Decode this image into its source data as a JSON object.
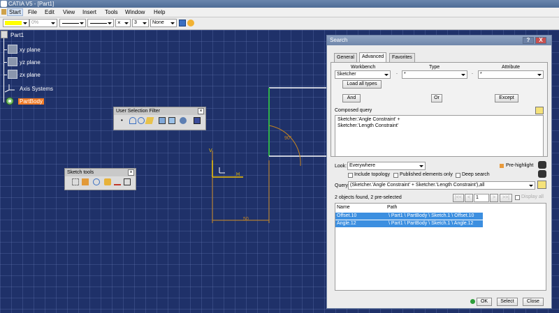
{
  "window": {
    "title": "CATIA V5 - [Part1]"
  },
  "menu": [
    "Start",
    "File",
    "Edit",
    "View",
    "Insert",
    "Tools",
    "Window",
    "Help"
  ],
  "style_toolbar": {
    "opacity": "0%",
    "thickness": "3",
    "layer": "None"
  },
  "tree": {
    "root": "Part1",
    "items": [
      "xy plane",
      "yz plane",
      "zx plane",
      "Axis Systems",
      "PartBody"
    ]
  },
  "sketch": {
    "angle_label": "90°",
    "length_label": "50",
    "axis_h": "H",
    "axis_v": "V"
  },
  "user_selection_filter": {
    "title": "User Selection Filter"
  },
  "sketch_tools": {
    "title": "Sketch tools"
  },
  "search": {
    "title": "Search",
    "help": "?",
    "close": "X",
    "tabs": [
      "General",
      "Advanced",
      "Favorites"
    ],
    "columns": {
      "workbench": "Workbench",
      "type": "Type",
      "attribute": "Attribute"
    },
    "workbench_value": "Sketcher",
    "type_value": "*",
    "attribute_value": "*",
    "load_all_types": "Load all types",
    "and": "And",
    "or": "Or",
    "except": "Except",
    "composed_query_label": "Composed query",
    "composed_query_lines": [
      "Sketcher.'Angle Constraint' +",
      "Sketcher.'Length Constraint'"
    ],
    "look_label": "Look:",
    "look_value": "Everywhere",
    "pre_highlight": "Pre-highlight",
    "include_topology": "Include topology",
    "published_only": "Published elements only",
    "deep_search": "Deep search",
    "query_label": "Query:",
    "query_value": "(Sketcher.'Angle Constraint' + Sketcher.'Length Constraint'),all",
    "found_text": "2 objects found, 2 pre-selected",
    "page_value": "1",
    "display_all": "Display all",
    "result_columns": {
      "name": "Name",
      "path": "Path"
    },
    "results": [
      {
        "name": "Offset.10",
        "path": "\\ Part1 \\ PartBody \\ Sketch.1 \\ Offset.10"
      },
      {
        "name": "Angle.12",
        "path": "\\ Part1 \\ PartBody \\ Sketch.1 \\ Angle.12"
      }
    ],
    "ok": "OK",
    "select": "Select",
    "close_button": "Close"
  },
  "colors": {
    "workspace": "#1f3169",
    "grid": "#6e82b9",
    "selection": "#3c8fe0",
    "partbody": "#f07a26",
    "dimension": "#c8861f"
  }
}
